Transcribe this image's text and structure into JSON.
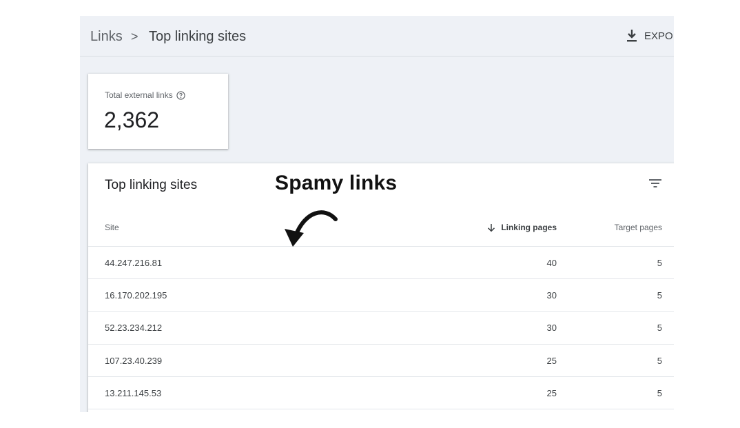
{
  "breadcrumb": {
    "root": "Links",
    "separator": ">",
    "current": "Top linking sites"
  },
  "toolbar": {
    "export_label": "EXPOI",
    "export_icon": "download-icon"
  },
  "summary_card": {
    "label": "Total external links",
    "help_icon": "help-circle-icon",
    "value": "2,362"
  },
  "panel": {
    "title": "Top linking sites",
    "filter_icon": "filter-icon"
  },
  "table": {
    "columns": {
      "site": "Site",
      "linking_pages": "Linking pages",
      "target_pages": "Target pages"
    },
    "sort_icon": "arrow-down-icon",
    "rows": [
      {
        "site": "44.247.216.81",
        "linking_pages": "40",
        "target_pages": "5"
      },
      {
        "site": "16.170.202.195",
        "linking_pages": "30",
        "target_pages": "5"
      },
      {
        "site": "52.23.234.212",
        "linking_pages": "30",
        "target_pages": "5"
      },
      {
        "site": "107.23.40.239",
        "linking_pages": "25",
        "target_pages": "5"
      },
      {
        "site": "13.211.145.53",
        "linking_pages": "25",
        "target_pages": "5"
      }
    ]
  },
  "annotation": {
    "text": "Spamy links",
    "arrow_icon": "curved-arrow-icon"
  },
  "colors": {
    "background": "#eef1f6",
    "surface": "#ffffff",
    "text_primary": "#202124",
    "text_secondary": "#5f6368",
    "divider": "#e3e6ea"
  }
}
